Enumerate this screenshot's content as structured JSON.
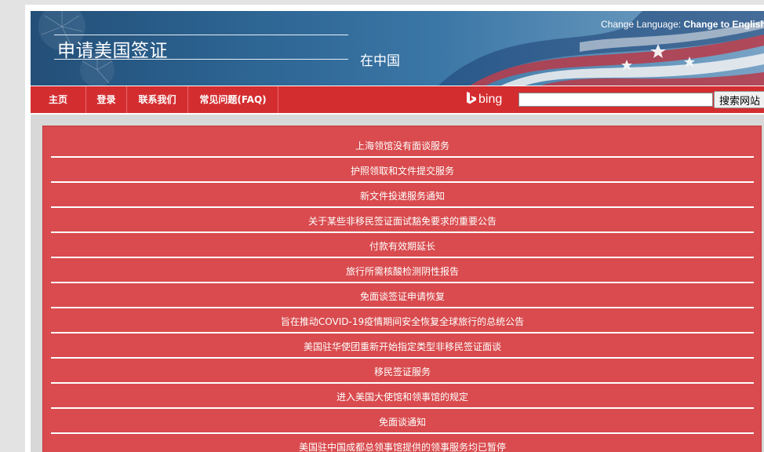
{
  "banner": {
    "title": "申请美国签证",
    "subtitle": "在中国",
    "language_label": "Change Language: ",
    "language_link": "Change to English"
  },
  "nav": {
    "items": [
      {
        "label": "主页"
      },
      {
        "label": "登录"
      },
      {
        "label": "联系我们"
      },
      {
        "label": "常见问题(FAQ)"
      }
    ],
    "bing_label": "bing",
    "search_placeholder": "",
    "search_button": "搜索网站"
  },
  "notices": [
    "上海领馆没有面谈服务",
    "护照领取和文件提交服务",
    "新文件投递服务通知",
    "关于某些非移民签证面试豁免要求的重要公告",
    "付款有效期延长",
    "旅行所需核酸检测阴性报告",
    "免面谈签证申请恢复",
    "旨在推动COVID-19疫情期间安全恢复全球旅行的总统公告",
    "美国驻华使团重新开始指定类型非移民签证面谈",
    "移民签证服务",
    "进入美国大使馆和领事馆的规定",
    "免面谈通知",
    "美国驻中国成都总领事馆提供的领事服务均已暂停"
  ],
  "colors": {
    "nav_red": "#d42d30",
    "panel_red": "#d94b4e",
    "banner_blue": "#2d6593"
  }
}
